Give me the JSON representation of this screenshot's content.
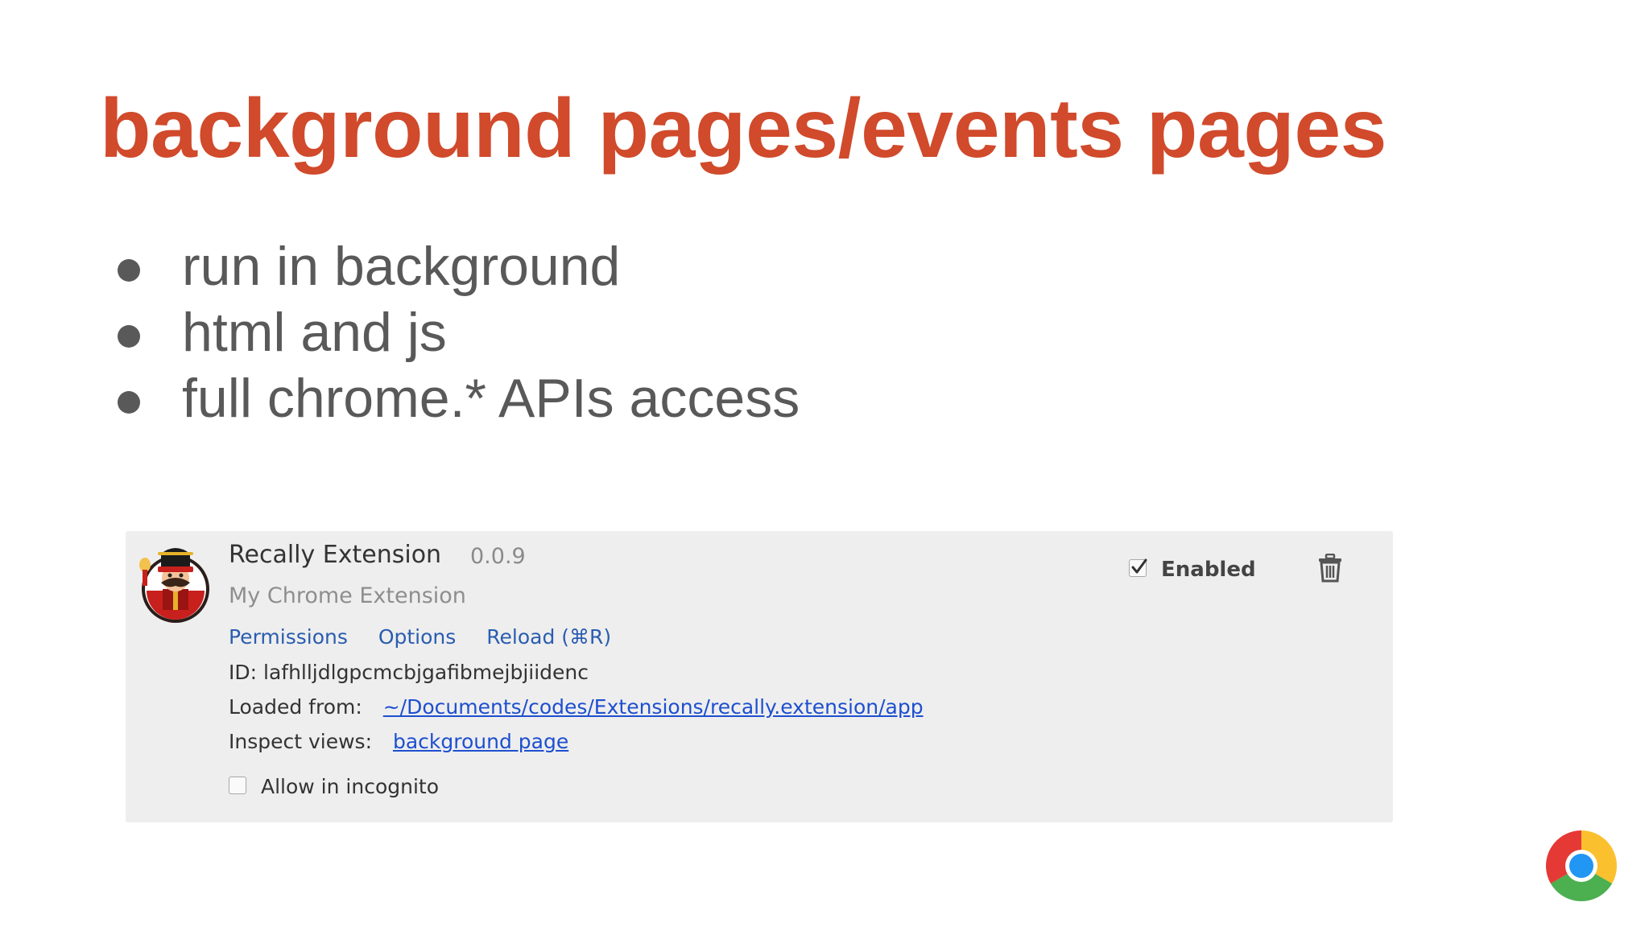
{
  "slide": {
    "title": "background pages/events pages",
    "bullets": [
      "run in background",
      "html and js",
      "full chrome.* APIs access"
    ]
  },
  "extension": {
    "name": "Recally Extension",
    "version": "0.0.9",
    "description": "My Chrome Extension",
    "links": {
      "permissions": "Permissions",
      "options": "Options",
      "reload": "Reload (⌘R)"
    },
    "id_label": "ID:",
    "id_value": "lafhlljdlgpcmcbjgafibmejbjiidenc",
    "loaded_from_label": "Loaded from:",
    "loaded_from_path": "~/Documents/codes/Extensions/recally.extension/app",
    "inspect_views_label": "Inspect views:",
    "inspect_views_link": "background page",
    "incognito_label": "Allow in incognito",
    "incognito_checked": false,
    "enabled_label": "Enabled",
    "enabled_checked": true
  },
  "icons": {
    "extension_icon": "mascot-icon",
    "trash": "trash-icon",
    "chrome": "chrome-logo-icon"
  },
  "colors": {
    "title": "#d04a2b",
    "bullet_text": "#595959",
    "card_background": "#eeeeee",
    "link": "#2a5db0"
  }
}
